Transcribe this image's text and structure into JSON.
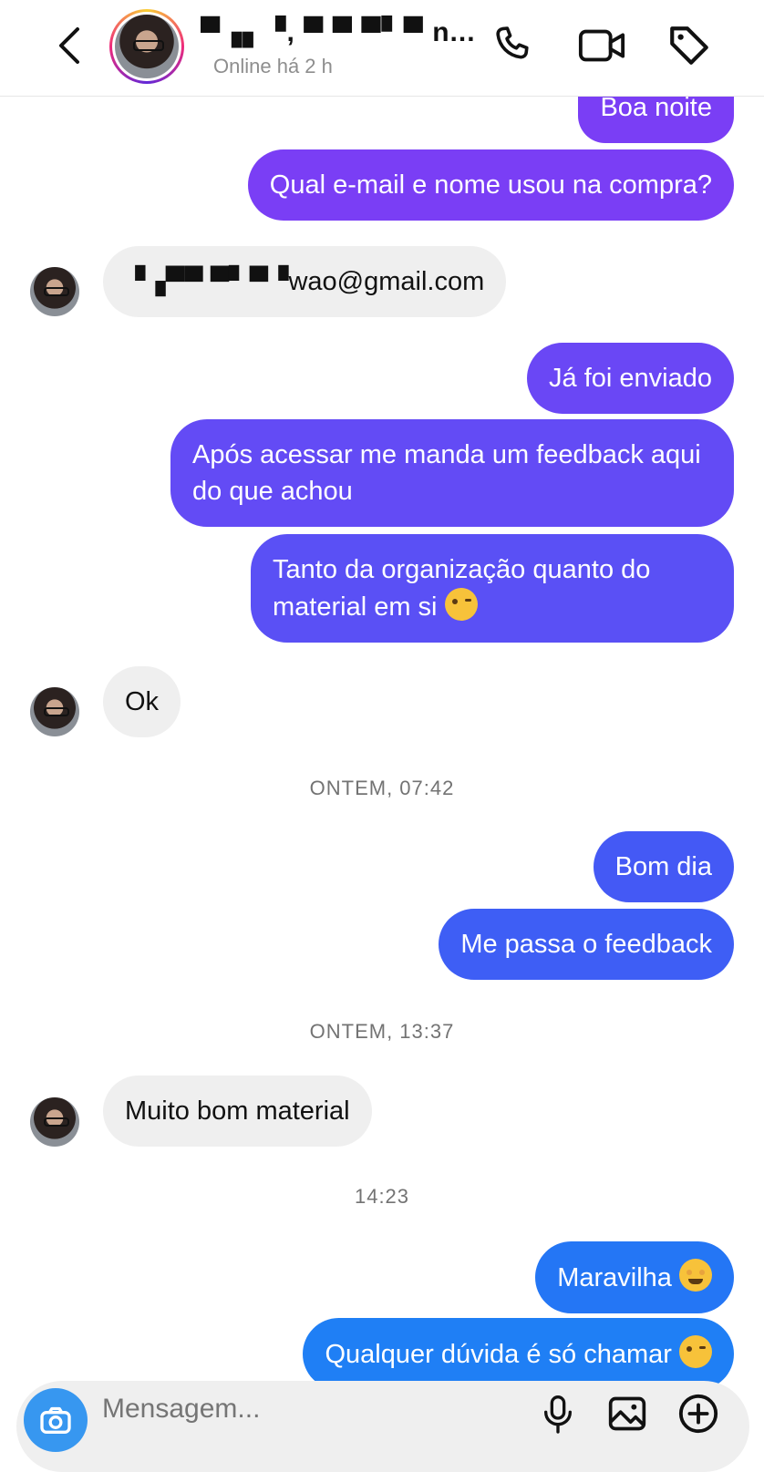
{
  "header": {
    "contact_name": "▀▗▖▝, ▀ ▀ ▀▘▀ n...",
    "status": "Online há 2 h"
  },
  "composer": {
    "placeholder": "Mensagem..."
  },
  "colors": {
    "bubble_gradient_top": "#7a3ef5",
    "bubble_gradient_mid": "#5751f5",
    "bubble_gradient_bottom": "#1f7ff5",
    "incoming_bubble": "#efefef",
    "camera_button": "#3797f0"
  },
  "messages": [
    {
      "dir": "out",
      "text": "Boa noite"
    },
    {
      "dir": "out",
      "text": "Qual e-mail e nome usou na compra?"
    },
    {
      "dir": "in",
      "text": "▝▗▀▀ ▀▘▀▝wao@gmail.com"
    },
    {
      "dir": "out",
      "text": "Já foi enviado"
    },
    {
      "dir": "out",
      "text": "Após acessar me manda um feedback aqui do que achou"
    },
    {
      "dir": "out",
      "text": "Tanto da organização quanto do material em si",
      "emoji": "winking-face"
    },
    {
      "dir": "in",
      "text": "Ok"
    },
    {
      "dir": "ts",
      "text": "ONTEM, 07:42"
    },
    {
      "dir": "out",
      "text": "Bom dia"
    },
    {
      "dir": "out",
      "text": "Me passa o feedback"
    },
    {
      "dir": "ts",
      "text": "ONTEM, 13:37"
    },
    {
      "dir": "in",
      "text": "Muito bom material"
    },
    {
      "dir": "ts",
      "text": "14:23"
    },
    {
      "dir": "out",
      "text": "Maravilha",
      "emoji": "star-struck"
    },
    {
      "dir": "out",
      "text": "Qualquer dúvida é só chamar",
      "emoji": "winking-face"
    }
  ]
}
